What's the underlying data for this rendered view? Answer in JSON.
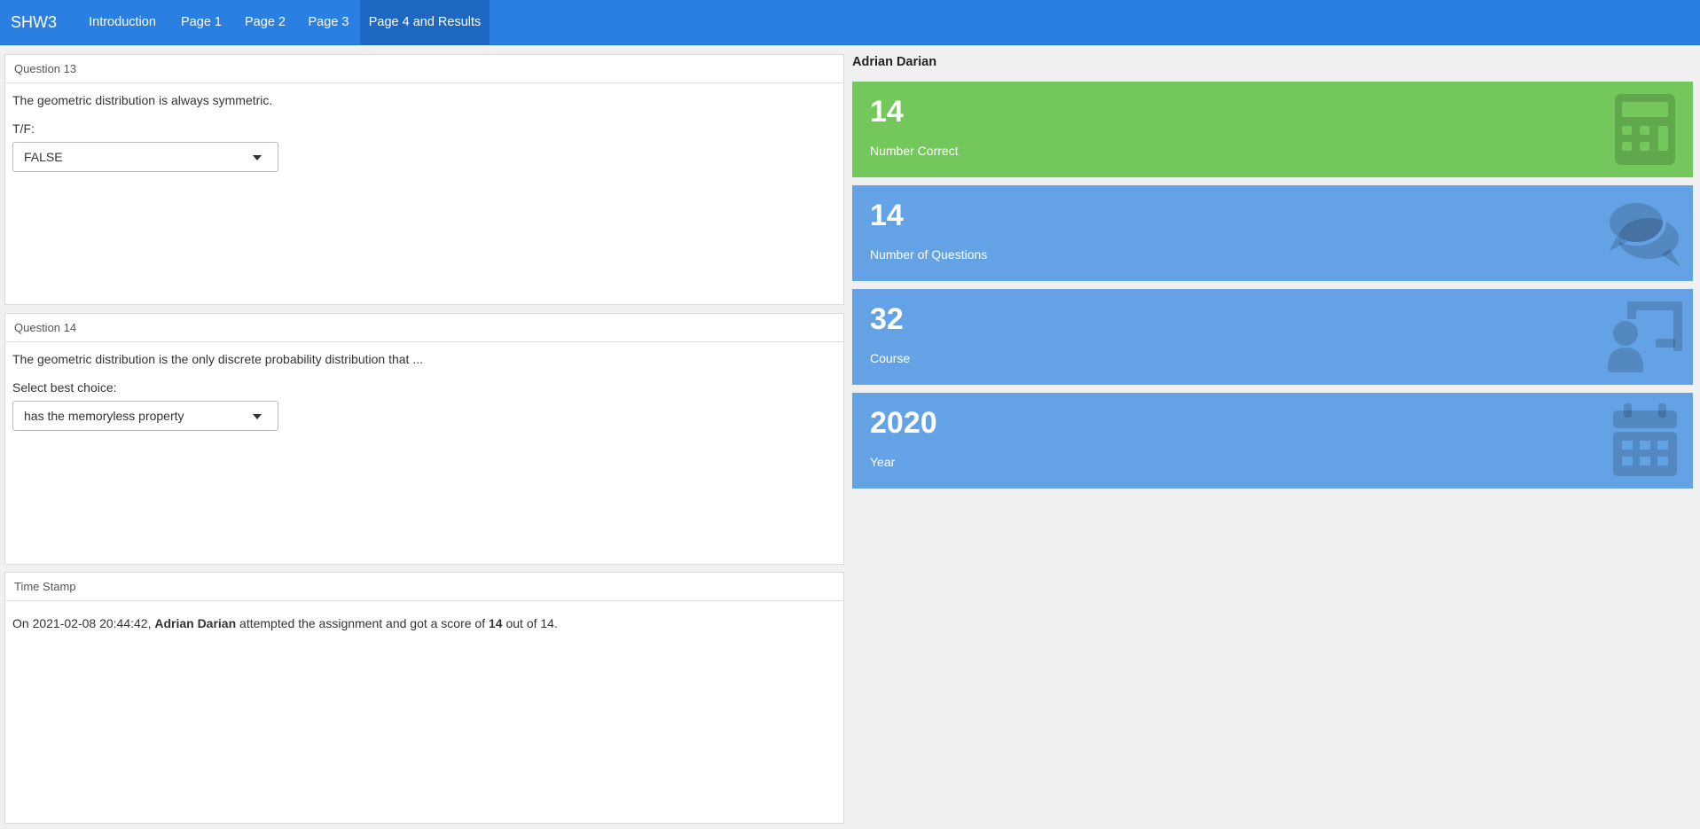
{
  "navbar": {
    "brand": "SHW3",
    "tabs": [
      {
        "label": "Introduction"
      },
      {
        "label": "Page 1"
      },
      {
        "label": "Page 2"
      },
      {
        "label": "Page 3"
      },
      {
        "label": "Page 4 and Results",
        "active": true
      }
    ]
  },
  "questions": [
    {
      "heading": "Question 13",
      "text": "The geometric distribution is always symmetric.",
      "input_label": "T/F:",
      "selected": "FALSE"
    },
    {
      "heading": "Question 14",
      "text": "The geometric distribution is the only discrete probability distribution that ...",
      "input_label": "Select best choice:",
      "selected": "has the memoryless property"
    }
  ],
  "timestamp": {
    "heading": "Time Stamp",
    "prefix": "On 2021-02-08 20:44:42, ",
    "name": "Adrian Darian",
    "middle": " attempted the assignment and got a score of ",
    "score": "14",
    "suffix": " out of 14."
  },
  "results": {
    "student_name": "Adrian Darian",
    "boxes": [
      {
        "value": "14",
        "label": "Number Correct",
        "icon": "calculator-icon",
        "color": "#74c85b"
      },
      {
        "value": "14",
        "label": "Number of Questions",
        "icon": "comments-icon",
        "color": "#64a2e6"
      },
      {
        "value": "32",
        "label": "Course",
        "icon": "chalkboard-teacher-icon",
        "color": "#64a2e6"
      },
      {
        "value": "2020",
        "label": "Year",
        "icon": "calendar-icon",
        "color": "#64a2e6"
      }
    ]
  }
}
